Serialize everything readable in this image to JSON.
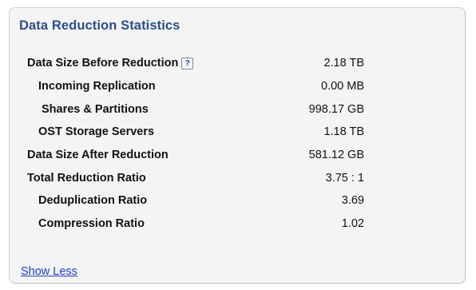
{
  "panel": {
    "title": "Data Reduction Statistics",
    "show_less_label": "Show Less"
  },
  "stats": [
    {
      "label": "Data Size Before Reduction",
      "value": "2.18 TB",
      "level": 0,
      "help_icon": "help-icon",
      "help_glyph": "?"
    },
    {
      "label": "Incoming Replication",
      "value": "0.00 MB",
      "level": 1
    },
    {
      "label": "Shares & Partitions",
      "value": "998.17 GB",
      "level": 2
    },
    {
      "label": "OST Storage Servers",
      "value": "1.18 TB",
      "level": 1
    },
    {
      "label": "Data Size After Reduction",
      "value": "581.12 GB",
      "level": 0
    },
    {
      "label": "Total Reduction Ratio",
      "value": "3.75 : 1",
      "level": 0
    },
    {
      "label": "Deduplication Ratio",
      "value": "3.69",
      "level": 1
    },
    {
      "label": "Compression Ratio",
      "value": "1.02",
      "level": 1
    }
  ],
  "colors": {
    "title": "#2b4f8c",
    "link": "#1a3ec8",
    "panel_background": "#f4f4f4",
    "panel_border": "#d2d2d2"
  }
}
